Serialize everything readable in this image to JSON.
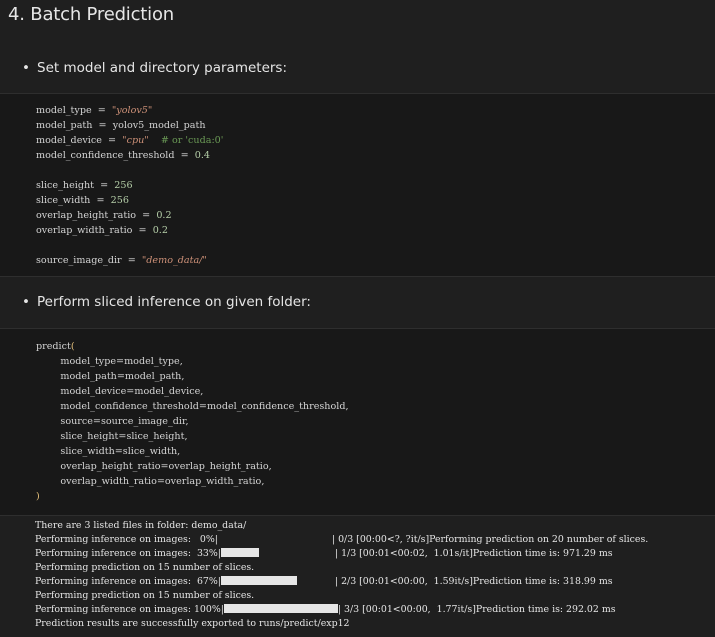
{
  "heading": "4. Batch Prediction",
  "bullets": {
    "bullet1": "Set model and directory parameters:",
    "bullet2": "Perform sliced inference on given folder:"
  },
  "cell1": {
    "lines": [
      [
        {
          "t": "model_type  =  ",
          "c": "kw"
        },
        {
          "t": "\"yolov5\"",
          "c": "str"
        }
      ],
      [
        {
          "t": "model_path  =  yolov5_model_path",
          "c": "kw"
        }
      ],
      [
        {
          "t": "model_device  =  ",
          "c": "kw"
        },
        {
          "t": "\"cpu\"",
          "c": "str"
        },
        {
          "t": "    # or ",
          "c": "cmt"
        },
        {
          "t": "'cuda:0'",
          "c": "cmt"
        }
      ],
      [
        {
          "t": "model_confidence_threshold  =  ",
          "c": "kw"
        },
        {
          "t": "0.4",
          "c": "num"
        }
      ],
      [],
      [
        {
          "t": "slice_height  =  ",
          "c": "kw"
        },
        {
          "t": "256",
          "c": "num"
        }
      ],
      [
        {
          "t": "slice_width  =  ",
          "c": "kw"
        },
        {
          "t": "256",
          "c": "num"
        }
      ],
      [
        {
          "t": "overlap_height_ratio  =  ",
          "c": "kw"
        },
        {
          "t": "0.2",
          "c": "num"
        }
      ],
      [
        {
          "t": "overlap_width_ratio  =  ",
          "c": "kw"
        },
        {
          "t": "0.2",
          "c": "num"
        }
      ],
      [],
      [
        {
          "t": "source_image_dir  =  ",
          "c": "kw"
        },
        {
          "t": "\"demo_data/\"",
          "c": "str"
        }
      ]
    ]
  },
  "cell2": {
    "lines": [
      [
        {
          "t": "predict",
          "c": "kw"
        },
        {
          "t": "(",
          "c": "paren"
        }
      ],
      [
        {
          "t": "        model_type=model_type,",
          "c": "kw"
        }
      ],
      [
        {
          "t": "        model_path=model_path,",
          "c": "kw"
        }
      ],
      [
        {
          "t": "        model_device=model_device,",
          "c": "kw"
        }
      ],
      [
        {
          "t": "        model_confidence_threshold=model_confidence_threshold,",
          "c": "kw"
        }
      ],
      [
        {
          "t": "        source=source_image_dir,",
          "c": "kw"
        }
      ],
      [
        {
          "t": "        slice_height=slice_height,",
          "c": "kw"
        }
      ],
      [
        {
          "t": "        slice_width=slice_width,",
          "c": "kw"
        }
      ],
      [
        {
          "t": "        overlap_height_ratio=overlap_height_ratio,",
          "c": "kw"
        }
      ],
      [
        {
          "t": "        overlap_width_ratio=overlap_width_ratio,",
          "c": "kw"
        }
      ],
      [
        {
          "t": ")",
          "c": "paren"
        }
      ]
    ]
  },
  "output": {
    "lines": [
      {
        "text": "There are 3 listed files in folder: demo_data/"
      },
      {
        "pre": "Performing inference on images:   0%|",
        "bar": 0.0,
        "post": "| 0/3 [00:00<?, ?it/s]Performing prediction on 20 number of slices."
      },
      {
        "pre": "Performing inference on images:  33%|",
        "bar": 0.333,
        "post": "| 1/3 [00:01<00:02,  1.01s/it]Prediction time is: 971.29 ms"
      },
      {
        "text": "Performing prediction on 15 number of slices."
      },
      {
        "pre": "Performing inference on images:  67%|",
        "bar": 0.667,
        "post": "| 2/3 [00:01<00:00,  1.59it/s]Prediction time is: 318.99 ms"
      },
      {
        "text": "Performing prediction on 15 number of slices."
      },
      {
        "pre": "Performing inference on images: 100%|",
        "bar": 1.0,
        "post": "| 3/3 [00:01<00:00,  1.77it/s]Prediction time is: 292.02 ms"
      },
      {
        "text": "Prediction results are successfully exported to runs/predict/exp12"
      }
    ]
  }
}
